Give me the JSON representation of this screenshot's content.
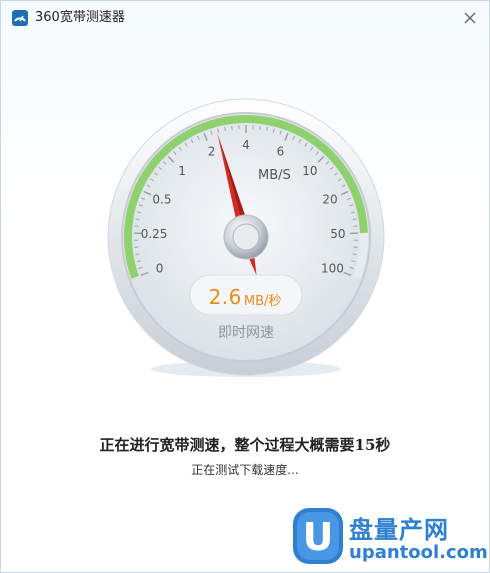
{
  "window": {
    "title": "360宽带测速器",
    "app_icon": "360-logo-icon",
    "close_icon": "close-icon"
  },
  "gauge": {
    "unit_label": "MB/S",
    "scale_labels": [
      "0",
      "0.25",
      "0.5",
      "1",
      "2",
      "4",
      "6",
      "10",
      "20",
      "50",
      "100"
    ],
    "needle_value": 2.6,
    "accent_color": "#8fd16f",
    "needle_color": "#d62a20"
  },
  "speed": {
    "value": "2.6",
    "unit": "MB/秒",
    "caption": "即时网速",
    "value_color": "#f08a19"
  },
  "status": {
    "main": "正在进行宽带测速，整个过程大概需要15秒",
    "sub": "正在测试下载速度..."
  },
  "watermark": {
    "text_cn": "盘量产网",
    "text_en": "upantool.com",
    "logo_letter": "U"
  }
}
